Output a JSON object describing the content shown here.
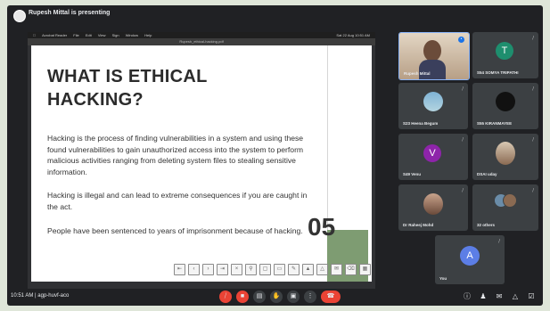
{
  "top_bar": {
    "presenting_label": "Rupesh Mittal is presenting"
  },
  "shared_screen": {
    "menubar_items": [
      "Acrobat Reader",
      "File",
      "Edit",
      "View",
      "Sign",
      "Window",
      "Help"
    ],
    "menubar_right": "Sat 22 Aug 10:51 AM",
    "pdf_filename": "Rupesh_ethical-hacking.pdf",
    "slide": {
      "title": "WHAT IS ETHICAL HACKING?",
      "paragraph_1": "Hacking is the process of finding vulnerabilities in a system and using these found vulnerabilities to gain unauthorized access into the system to perform malicious activities ranging from deleting system files to stealing sensitive information.",
      "paragraph_2": "Hacking is illegal and can lead to extreme consequences if you are caught in the act.",
      "paragraph_3": "People have been sentenced to years of imprisonment because of hacking.",
      "number": "05",
      "accent_color": "#7e9c72"
    }
  },
  "participants": [
    {
      "name": "Rupesh Mittal",
      "avatar": "video",
      "color": "#6b5a4a"
    },
    {
      "name": "S54 SOMYA TRIPATHI",
      "avatar": "T",
      "color": "#1e8e6e"
    },
    {
      "name": "S23 Heena Begum",
      "avatar": "photo",
      "color": "#7fb3d5"
    },
    {
      "name": "S55 KIRANMAYEE",
      "avatar": "photo",
      "color": "#1a1a1a"
    },
    {
      "name": "S49 Venu",
      "avatar": "V",
      "color": "#8e24aa"
    },
    {
      "name": "DSAI uday",
      "avatar": "photo",
      "color": "#c9b8a4"
    },
    {
      "name": "Dr Raheej Mohd",
      "avatar": "photo",
      "color": "#a5806a"
    },
    {
      "name": "32 others",
      "avatar": "group",
      "color": "#5a6b7a"
    },
    {
      "name": "You",
      "avatar": "A",
      "color": "#5c7ee6"
    }
  ],
  "bottom_bar": {
    "time": "10:51 AM",
    "separator": "|",
    "meeting_code": "agp-huvf-aco"
  },
  "icons": {
    "mic": "mic-off-icon",
    "camera": "camera-off-icon",
    "captions": "captions-icon",
    "raise_hand": "raise-hand-icon",
    "present": "present-icon",
    "more": "more-options-icon",
    "end_call": "end-call-icon"
  }
}
